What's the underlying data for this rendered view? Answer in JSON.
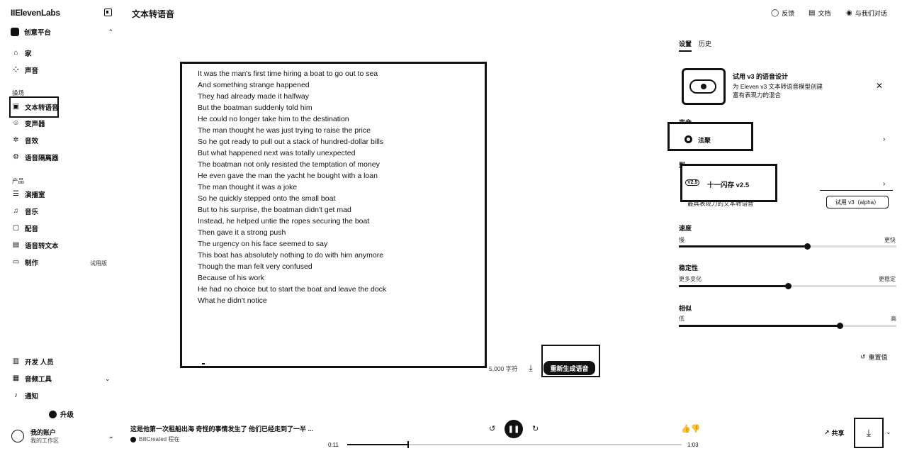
{
  "app": {
    "logo": "IIElevenLabs",
    "page_title": "文本转语音"
  },
  "sidebar": {
    "workspace": "创意平台",
    "items_top": [
      {
        "label": "家",
        "icon": "home-icon"
      },
      {
        "label": "声音",
        "icon": "voices-icon"
      }
    ],
    "section_playground": "操场",
    "items_playground": [
      {
        "label": "文本转语音",
        "icon": "tts-icon"
      },
      {
        "label": "变声器",
        "icon": "voice-changer-icon"
      },
      {
        "label": "音效",
        "icon": "sound-effects-icon"
      },
      {
        "label": "语音隔离器",
        "icon": "voice-isolator-icon"
      }
    ],
    "section_products": "产品",
    "items_products": [
      {
        "label": "演播室",
        "icon": "studio-icon"
      },
      {
        "label": "音乐",
        "icon": "music-icon"
      },
      {
        "label": "配音",
        "icon": "dubbing-icon"
      },
      {
        "label": "语音转文本",
        "icon": "speech-to-text-icon"
      },
      {
        "label": "制作",
        "icon": "productions-icon",
        "badge": "试用版"
      }
    ],
    "items_bottom": [
      {
        "label": "开发 人员",
        "icon": "developers-icon"
      },
      {
        "label": "音频工具",
        "icon": "audio-tools-icon"
      },
      {
        "label": "通知",
        "icon": "bell-icon"
      }
    ],
    "upgrade": "升级",
    "account_name": "我的账户",
    "account_sub": "我的工作区"
  },
  "header": {
    "feedback": "反馈",
    "docs": "文档",
    "chat": "与我们对话"
  },
  "editor": {
    "lines": [
      "It was the man's first time hiring a boat to go out to sea",
      "And something strange happened",
      "They had already made it halfway",
      "But the boatman suddenly told him",
      "He could no longer take him to the destination",
      "The man thought he was just trying to raise the price",
      "So he got ready to pull out a stack of hundred-dollar bills",
      "But what happened next was totally unexpected",
      "The boatman not only resisted the temptation of money",
      "He even gave the man the yacht he bought with a loan",
      "The man thought it was a joke",
      "So he quickly stepped onto the small boat",
      "But to his surprise, the boatman didn't get mad",
      "Instead, he helped untie the ropes securing the boat",
      "Then gave it a strong push",
      "The urgency on his face seemed to say",
      "This boat has absolutely nothing to do with him anymore",
      "Though the man felt very confused",
      "Because of his work",
      "He had no choice but to start the boat and leave the dock",
      "What he didn't notice"
    ],
    "char_count": "5,000 字符",
    "regenerate": "重新生成语音"
  },
  "panel": {
    "tabs": [
      "设置",
      "历史"
    ],
    "promo_title": "试用 v3 的语音设计",
    "promo_desc": "为 Eleven v3 文本转语音模型创建富有表现力的混合",
    "voice_label": "声音",
    "voice_name": "法聚",
    "model_label": "型",
    "model_badge": "V2.5",
    "model_name": "十一闪存 v2.5",
    "model_desc": "最具表现力的文本转语音",
    "try_v3": "试用 v3（alpha）",
    "sliders": [
      {
        "label": "速度",
        "min": "慢",
        "max": "更快",
        "value": 0.59
      },
      {
        "label": "稳定性",
        "min": "更多变化",
        "max": "更稳定",
        "value": 0.5
      },
      {
        "label": "相似",
        "min": "低",
        "max": "高",
        "value": 0.74
      }
    ],
    "reset": "重置值"
  },
  "player": {
    "title": "这是他第一次租船出海 奇怪的事情发生了 他们已经走到了一半 ...",
    "subtitle": "BillCreated 程在",
    "current_time": "0:11",
    "total_time": "1:03",
    "progress": 0.18,
    "share": "共享"
  }
}
